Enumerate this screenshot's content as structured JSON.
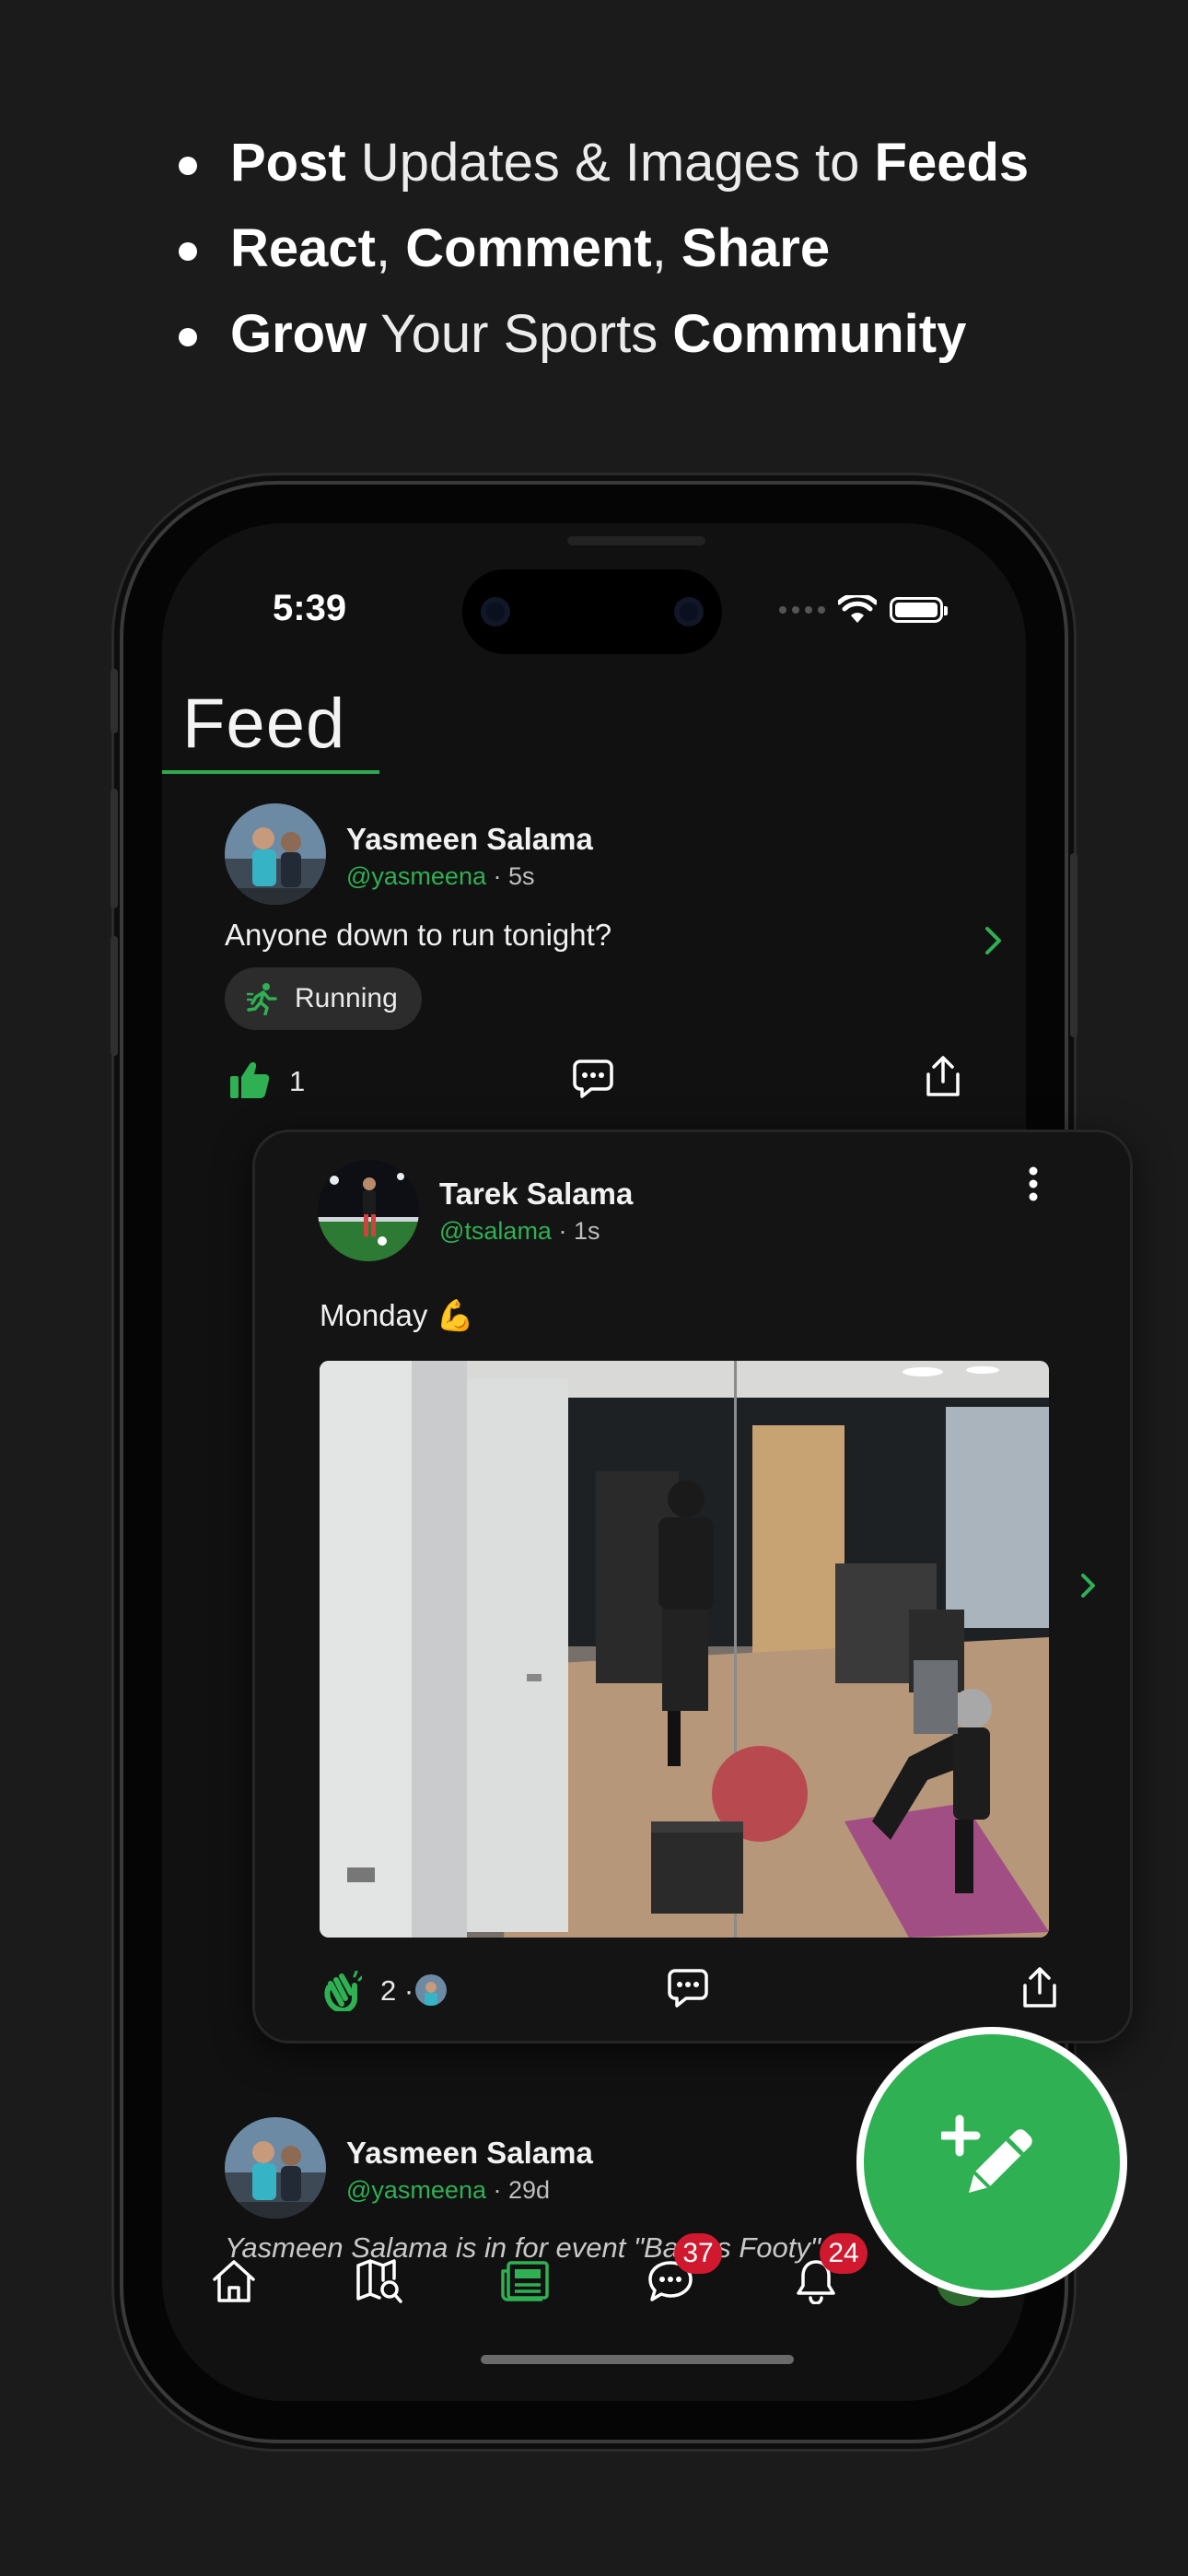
{
  "marketing": {
    "line1": {
      "b1": "Post",
      "t1": " Updates & Images to ",
      "b2": "Feeds"
    },
    "line2": {
      "b1": "React",
      "t1": ", ",
      "b2": "Comment",
      "t2": ", ",
      "b3": "Share"
    },
    "line3": {
      "b1": "Grow",
      "t1": " Your Sports ",
      "b2": "Community"
    }
  },
  "status_bar": {
    "time": "5:39"
  },
  "header": {
    "title": "Feed"
  },
  "posts": [
    {
      "author": "Yasmeen Salama",
      "handle": "@yasmeena",
      "time_ago": " · 5s",
      "text": "Anyone down to run tonight?",
      "tag": "Running",
      "like_count": "1"
    },
    {
      "author": "Tarek Salama",
      "handle": "@tsalama",
      "time_ago": " · 1s",
      "text": "Monday 💪",
      "like_count": "2 ·"
    },
    {
      "author": "Yasmeen Salama",
      "handle": "@yasmeena",
      "time_ago": " · 29d",
      "text": "Yasmeen Salama is in for event \"Ballers Footy\""
    }
  ],
  "nav": {
    "items": [
      "home",
      "map-search",
      "feed",
      "chat",
      "notifications",
      "profile"
    ],
    "chat_badge": "37",
    "notifications_badge": "24"
  },
  "colors": {
    "accent": "#2fb053",
    "badge": "#d0192f",
    "background": "#1b1b1b"
  }
}
